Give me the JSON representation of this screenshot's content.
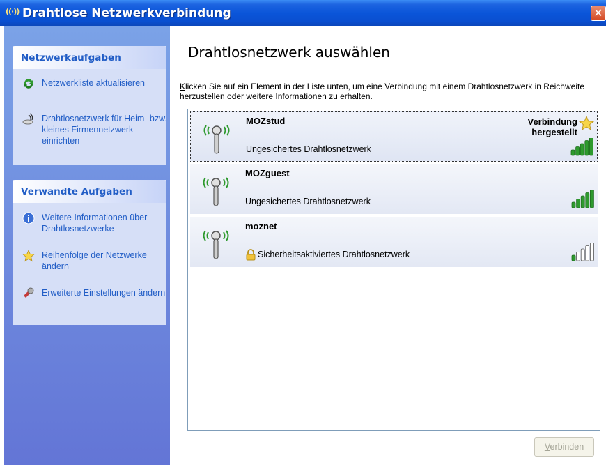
{
  "window": {
    "title": "Drahtlose Netzwerkverbindung",
    "close_label": "✕"
  },
  "sidebar": {
    "network_tasks": {
      "header": "Netzwerkaufgaben",
      "items": [
        {
          "label": "Netzwerkliste aktualisieren",
          "icon": "refresh-icon"
        },
        {
          "label": "Drahtlosnetzwerk für Heim- bzw. kleines Firmennetzwerk einrichten",
          "icon": "wireless-setup-icon"
        }
      ]
    },
    "related_tasks": {
      "header": "Verwandte Aufgaben",
      "items": [
        {
          "label": "Weitere Informationen über Drahtlosnetzwerke",
          "icon": "info-icon"
        },
        {
          "label": "Reihenfolge der Netzwerke ändern",
          "icon": "star-icon"
        },
        {
          "label": "Erweiterte Einstellungen ändern",
          "icon": "settings-icon"
        }
      ]
    }
  },
  "main": {
    "heading": "Drahtlosnetzwerk auswählen",
    "instructions_first_letter": "K",
    "instructions_rest": "licken Sie auf ein Element in der Liste unten, um eine Verbindung mit einem Drahtlosnetzwerk in Reichweite herzustellen oder weitere Informationen zu erhalten.",
    "networks": [
      {
        "name": "MOZstud",
        "description": "Ungesichertes Drahtlosnetzwerk",
        "status_line1": "Verbindung",
        "status_line2": "hergestellt",
        "secured": false,
        "signal_bars": 5,
        "selected": true
      },
      {
        "name": "MOZguest",
        "description": "Ungesichertes Drahtlosnetzwerk",
        "status_line1": "",
        "status_line2": "",
        "secured": false,
        "signal_bars": 5,
        "selected": false
      },
      {
        "name": "moznet",
        "description": "Sicherheitsaktiviertes Drahtlosnetzwerk",
        "status_line1": "",
        "status_line2": "",
        "secured": true,
        "signal_bars": 1,
        "selected": false
      }
    ],
    "connect_button_first_letter": "V",
    "connect_button_rest": "erbinden"
  },
  "colors": {
    "titlebar": "#0a55d9",
    "taskpane": "#6f8ee0",
    "link": "#215dc6",
    "signal_on": "#2e9a2e",
    "signal_off": "#ffffff"
  }
}
